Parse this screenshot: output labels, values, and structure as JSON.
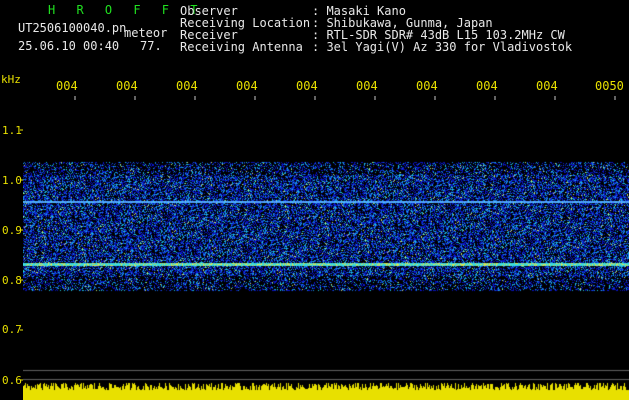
{
  "header": {
    "app_title": "H R O F F T",
    "filename": "UT2506100040.pn",
    "filetype": "meteor",
    "datetime": "25.06.10 00:40",
    "count": "77.",
    "info": [
      {
        "label": "Observer",
        "value": ": Masaki Kano"
      },
      {
        "label": "Receiving Location",
        "value": ": Shibukawa, Gunma, Japan"
      },
      {
        "label": "Receiver",
        "value": ": RTL-SDR SDR# 43dB L15 103.2MHz CW"
      },
      {
        "label": "Receiving Antenna",
        "value": ": 3el Yagi(V) Az 330 for Vladivostok"
      }
    ]
  },
  "x_ticks": [
    "004",
    "004",
    "004",
    "004",
    "004",
    "004",
    "004",
    "004",
    "004",
    "0050"
  ],
  "y_axis": {
    "unit": "kHz",
    "ticks": [
      "1.1",
      "1.0",
      "0.9",
      "0.8",
      "0.7",
      "0.6"
    ]
  },
  "colors": {
    "text": "#e8e8e8",
    "title": "#20e020",
    "axis": "#e8e000",
    "background": "#000000"
  }
}
